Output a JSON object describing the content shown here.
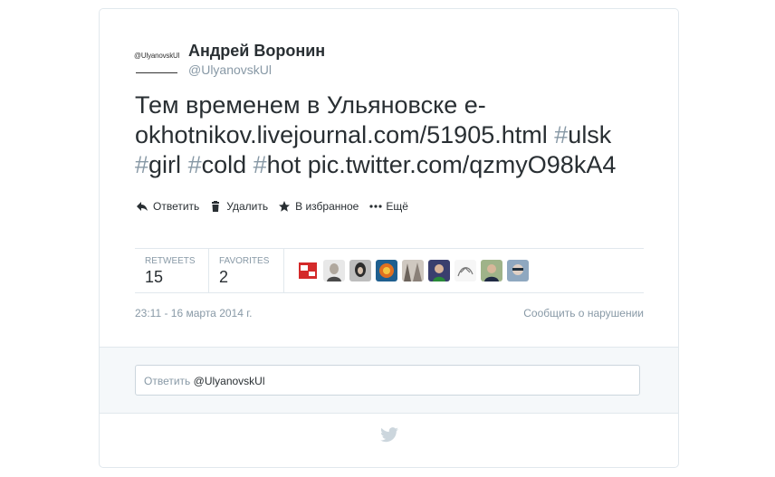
{
  "author": {
    "name": "Андрей Воронин",
    "handle": "@UlyanovskUl",
    "avatar_text": "@UlyanovskUl"
  },
  "tweet": {
    "line1": "Тем временем в Ульяновске е-",
    "line2_link": "okhotnikov.livejournal.com/51905.html",
    "tags": [
      "ulsk",
      "girl",
      "cold",
      "hot"
    ],
    "hash": "#",
    "pic_link": "pic.twitter.com/qzmyO98kA4"
  },
  "actions": {
    "reply": "Ответить",
    "delete": "Удалить",
    "favorite": "В избранное",
    "more": "Ещё"
  },
  "stats": {
    "retweets_label": "RETWEETS",
    "retweets_value": "15",
    "favorites_label": "FAVORITES",
    "favorites_value": "2"
  },
  "favoriters": [
    {
      "icon": "avatar-red-logo",
      "color": "#d42a2a"
    },
    {
      "icon": "avatar-person-1",
      "color": "#c8c8c8"
    },
    {
      "icon": "avatar-person-2",
      "color": "#555555"
    },
    {
      "icon": "avatar-colorful",
      "color": "#e07020"
    },
    {
      "icon": "avatar-person-3",
      "color": "#9a8f86"
    },
    {
      "icon": "avatar-person-4",
      "color": "#3a3f6e"
    },
    {
      "icon": "avatar-sketch",
      "color": "#e6e6e6"
    },
    {
      "icon": "avatar-person-5",
      "color": "#6f7d5b"
    },
    {
      "icon": "avatar-person-6",
      "color": "#8fa8c0"
    }
  ],
  "meta": {
    "timestamp": "23:11 - 16 марта 2014 г.",
    "report": "Сообщить о нарушении"
  },
  "reply": {
    "prefix": "Ответить",
    "handle": "@UlyanovskUl"
  },
  "colors": {
    "text": "#292f33",
    "muted": "#8899a6",
    "border": "#e1e8ed",
    "reply_bg": "#f5f8fa",
    "bird": "#ccd6dd"
  }
}
